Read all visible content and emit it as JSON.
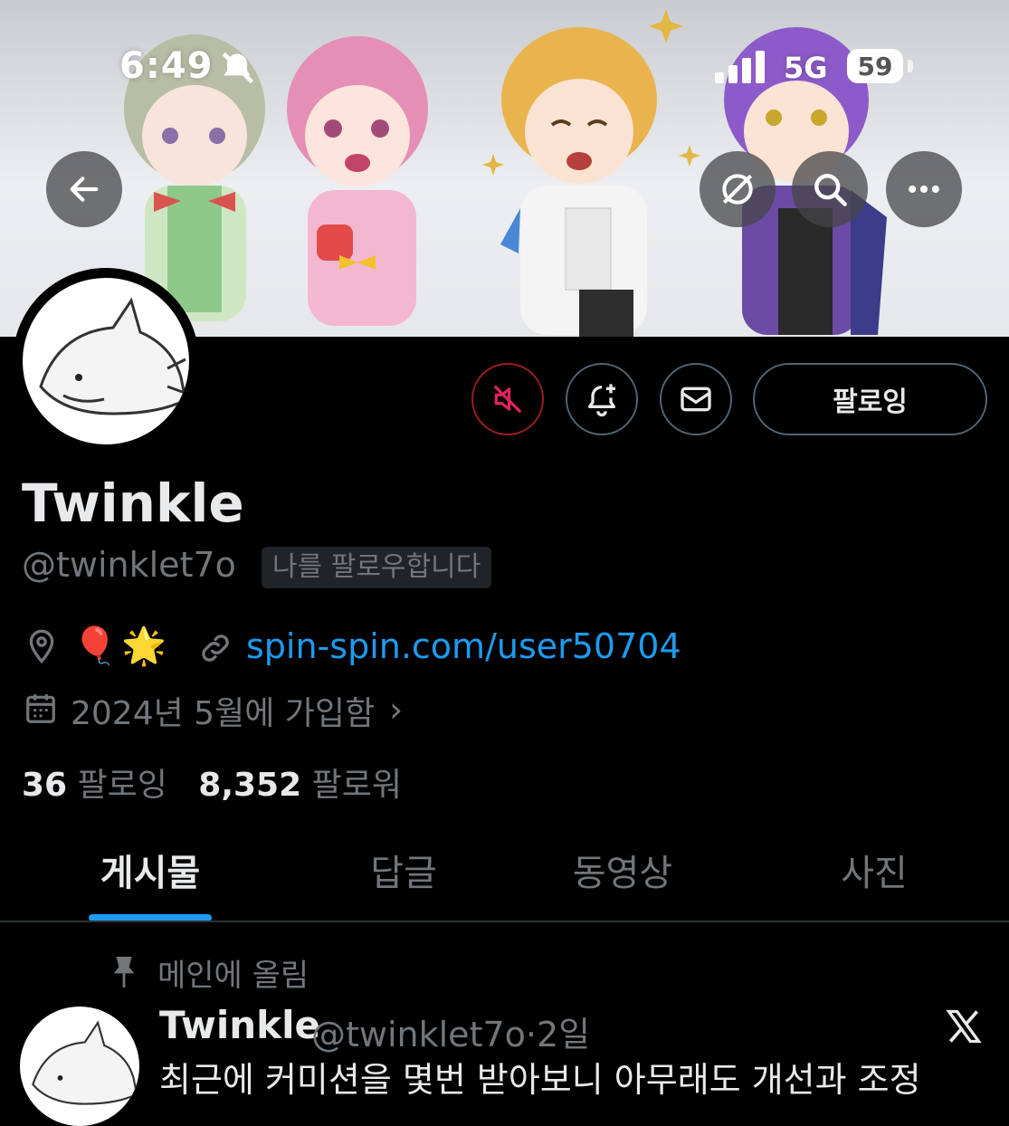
{
  "status_bar": {
    "time": "6:49",
    "network": "5G",
    "battery": "59"
  },
  "banner_buttons": {
    "back_icon": "arrow-left-icon",
    "grok_icon": "grok-icon",
    "search_icon": "search-icon",
    "more_icon": "more-icon"
  },
  "profile": {
    "display_name": "Twinkle",
    "handle": "@twinklet7o",
    "follows_you_badge": "나를 팔로우합니다",
    "location_emojis": [
      "🎈",
      "🌟"
    ],
    "website": "spin-spin.com/user50704",
    "joined": "2024년 5월에 가입함",
    "following_count": "36",
    "following_label": "팔로잉",
    "followers_count": "8,352",
    "followers_label": "팔로워"
  },
  "actions": {
    "follow_button": "팔로잉",
    "muted_color": "#9b1c21"
  },
  "tabs": [
    {
      "label": "게시물",
      "active": true
    },
    {
      "label": "답글",
      "active": false
    },
    {
      "label": "동영상",
      "active": false
    },
    {
      "label": "사진",
      "active": false
    }
  ],
  "pinned_post": {
    "pinned_label": "메인에 올림",
    "author_name": "Twinkle",
    "author_handle": "@twinklet7o",
    "separator": "·",
    "time": "2일",
    "text": "최근에 커미션을 몇번 받아보니 아무래도 개선과 조정"
  },
  "colors": {
    "accent": "#1d9bf0",
    "background": "#000000",
    "secondary_text": "#71767b"
  }
}
